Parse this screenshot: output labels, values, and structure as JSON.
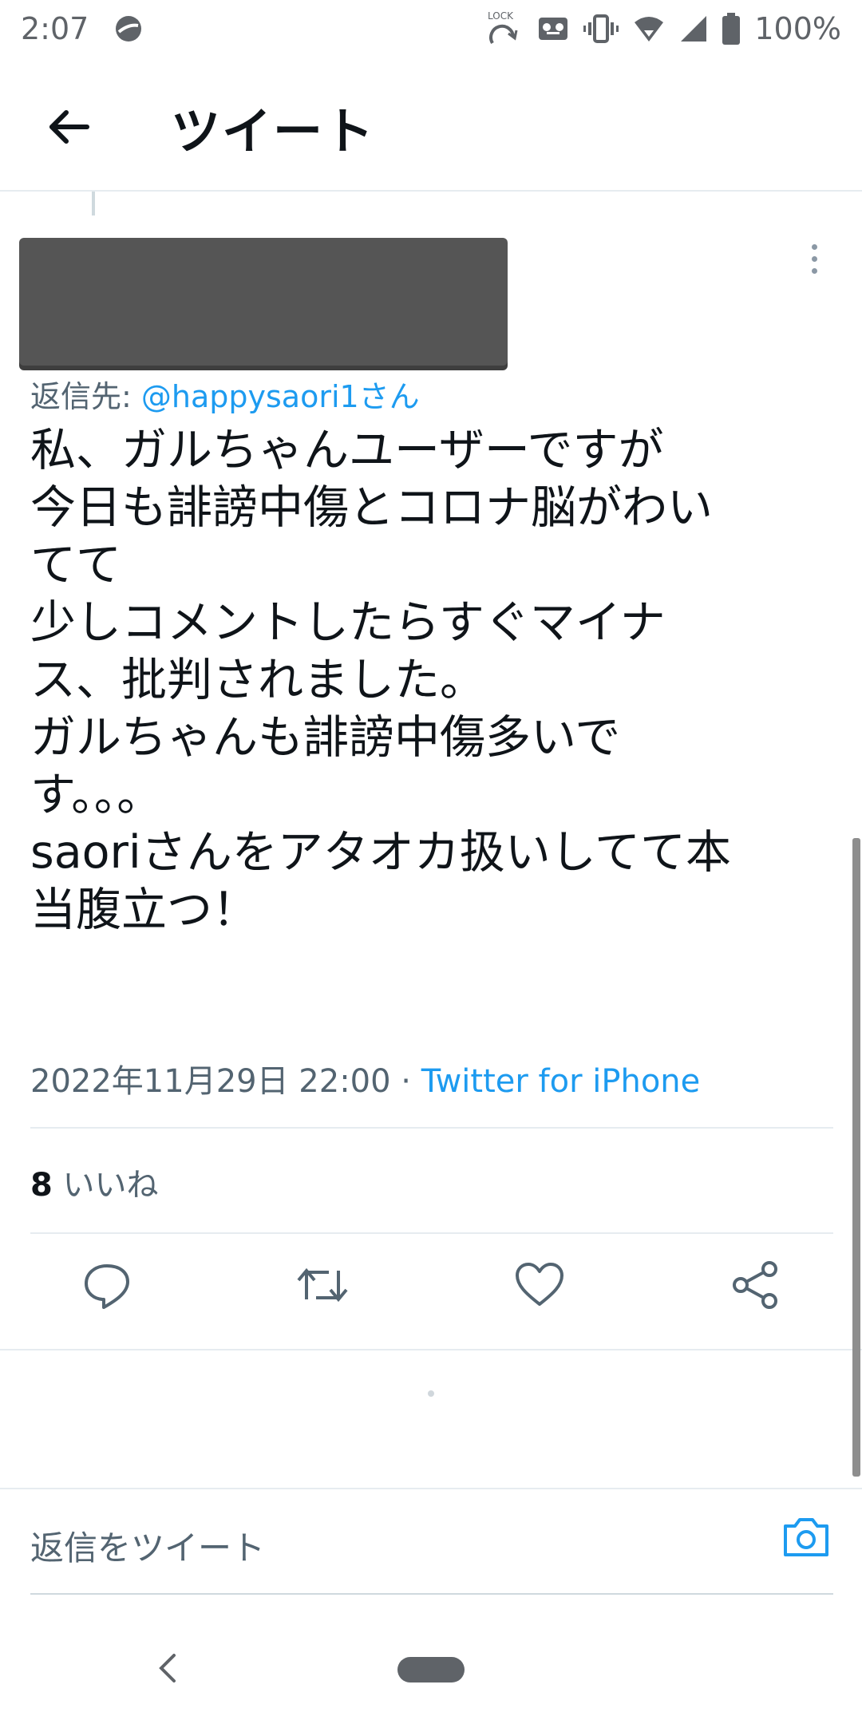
{
  "status_bar": {
    "time": "2:07",
    "lock_label": "LOCK",
    "battery": "100%",
    "icons": [
      "app-circle-icon",
      "rotation-lock-icon",
      "voicemail-icon",
      "vibrate-icon",
      "wifi-icon",
      "signal-icon",
      "battery-icon"
    ]
  },
  "header": {
    "title": "ツイート",
    "back_icon": "arrow-left-icon"
  },
  "tweet": {
    "reply_prefix": "返信先: ",
    "reply_mention": "@happysaori1さん",
    "text": "私、ガルちゃんユーザーですが\n今日も誹謗中傷とコロナ脳がわい\nてて\n少しコメントしたらすぐマイナ\nス、批判されました。\nガルちゃんも誹謗中傷多いで\nす。。。\nsaoriさんをアタオカ扱いしてて本\n当腹立つ！",
    "timestamp": "2022年11月29日 22:00",
    "separator": " · ",
    "source": "Twitter for iPhone",
    "likes_count": "8",
    "likes_label": " いいね"
  },
  "actions": [
    {
      "name": "reply-button",
      "icon": "reply-icon"
    },
    {
      "name": "retweet-button",
      "icon": "retweet-icon"
    },
    {
      "name": "like-button",
      "icon": "heart-icon"
    },
    {
      "name": "share-button",
      "icon": "share-icon"
    }
  ],
  "compose": {
    "placeholder": "返信をツイート",
    "camera_icon": "camera-icon"
  },
  "colors": {
    "accent": "#1d9bf0",
    "text_primary": "#0f1419",
    "text_secondary": "#536471",
    "divider": "#e6ecf0"
  }
}
